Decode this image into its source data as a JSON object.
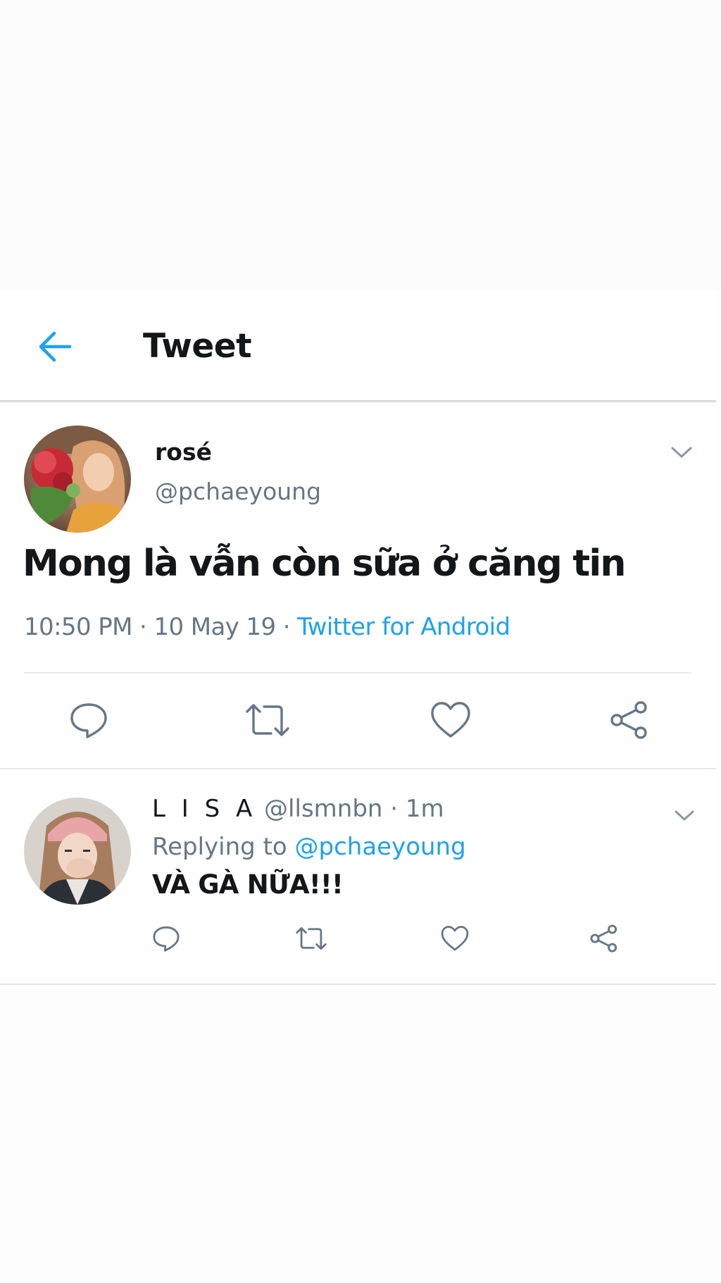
{
  "header": {
    "title": "Tweet",
    "back_icon": "arrow-left-icon",
    "accent_color": "#1da1f2"
  },
  "tweet": {
    "display_name": "rosé",
    "handle": "@pchaeyoung",
    "text": "Mong là vẫn còn sữa ở căng tin",
    "time": "10:50 PM",
    "separator": " · ",
    "date": "10 May 19",
    "source": "Twitter for Android",
    "menu_icon": "chevron-down-icon",
    "actions": [
      {
        "name": "reply",
        "icon": "reply-icon"
      },
      {
        "name": "retweet",
        "icon": "retweet-icon"
      },
      {
        "name": "like",
        "icon": "heart-icon"
      },
      {
        "name": "share",
        "icon": "share-icon"
      }
    ]
  },
  "reply": {
    "display_name": "L I S A",
    "handle": "@llsmnbn",
    "separator": " · ",
    "time": "1m",
    "replying_prefix": "Replying to ",
    "replying_to": "@pchaeyoung",
    "text": "VÀ GÀ NỮA!!!",
    "menu_icon": "chevron-down-icon",
    "actions": [
      {
        "name": "reply",
        "icon": "reply-icon"
      },
      {
        "name": "retweet",
        "icon": "retweet-icon"
      },
      {
        "name": "like",
        "icon": "heart-icon"
      },
      {
        "name": "share",
        "icon": "share-icon"
      }
    ]
  },
  "colors": {
    "text_primary": "#14171a",
    "text_secondary": "#657786",
    "link": "#1da1f2",
    "divider": "#e1e8ed"
  }
}
